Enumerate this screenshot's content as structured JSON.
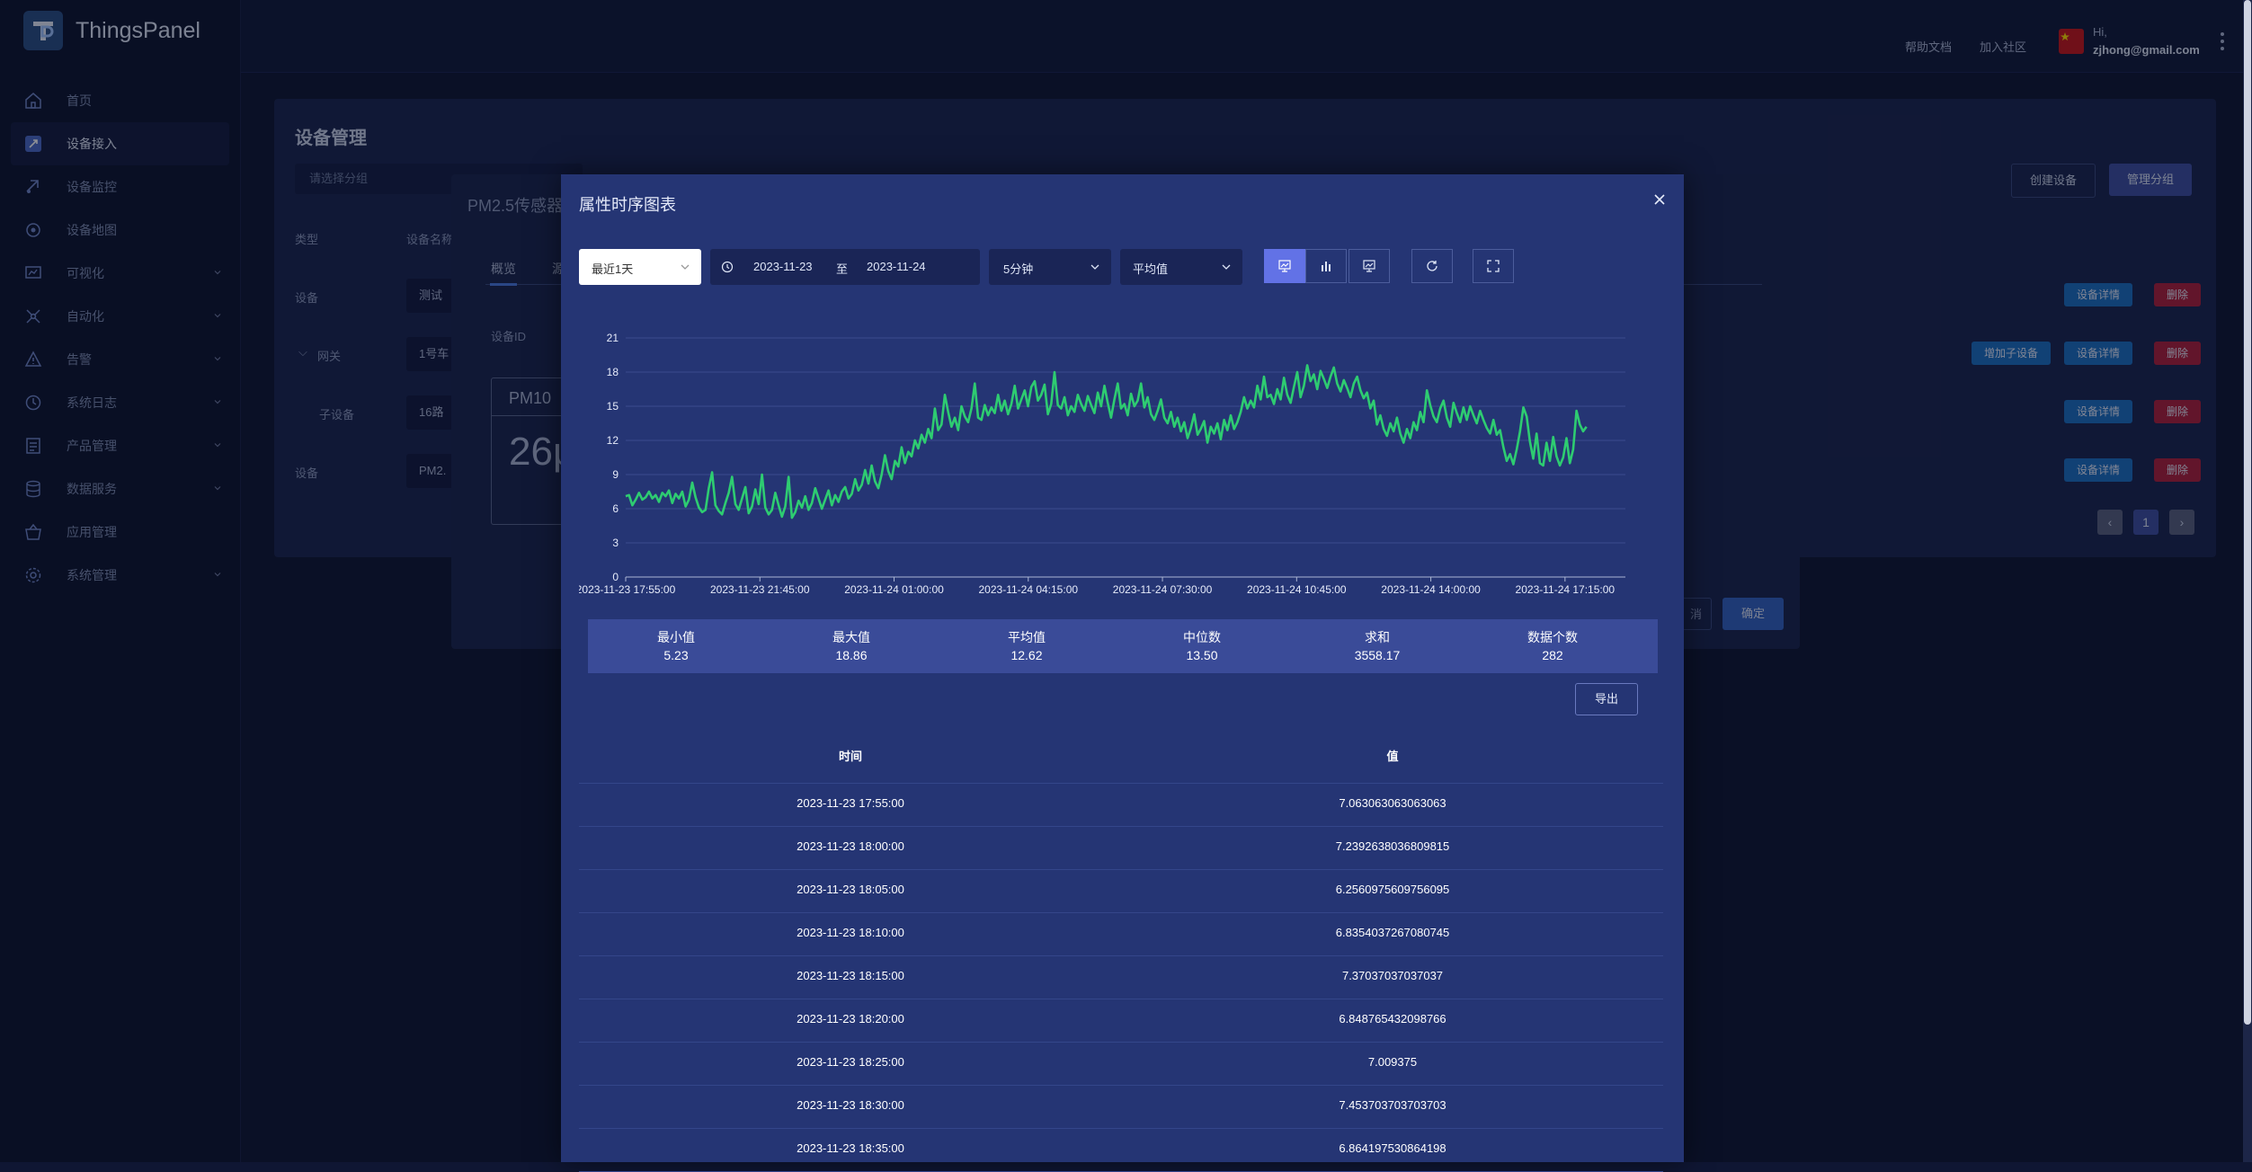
{
  "app": {
    "name": "ThingsPanel"
  },
  "sidebar": {
    "items": [
      {
        "label": "首页",
        "icon": "home-icon",
        "active": false,
        "expandable": false
      },
      {
        "label": "设备接入",
        "icon": "device-access-icon",
        "active": true,
        "expandable": false
      },
      {
        "label": "设备监控",
        "icon": "device-monitor-icon",
        "active": false,
        "expandable": false
      },
      {
        "label": "设备地图",
        "icon": "device-map-icon",
        "active": false,
        "expandable": false
      },
      {
        "label": "可视化",
        "icon": "visualization-icon",
        "active": false,
        "expandable": true
      },
      {
        "label": "自动化",
        "icon": "automation-icon",
        "active": false,
        "expandable": true
      },
      {
        "label": "告警",
        "icon": "alarm-icon",
        "active": false,
        "expandable": true
      },
      {
        "label": "系统日志",
        "icon": "system-log-icon",
        "active": false,
        "expandable": true
      },
      {
        "label": "产品管理",
        "icon": "product-icon",
        "active": false,
        "expandable": true
      },
      {
        "label": "数据服务",
        "icon": "data-service-icon",
        "active": false,
        "expandable": true
      },
      {
        "label": "应用管理",
        "icon": "app-management-icon",
        "active": false,
        "expandable": false
      },
      {
        "label": "系统管理",
        "icon": "system-settings-icon",
        "active": false,
        "expandable": true
      }
    ]
  },
  "header": {
    "help_docs": "帮助文档",
    "join_community": "加入社区",
    "greeting": "Hi,",
    "email": "zjhong@gmail.com"
  },
  "background": {
    "title": "设备管理",
    "group_select_placeholder": "请选择分组",
    "create_device": "创建设备",
    "manage_group": "管理分组",
    "col_type": "类型",
    "col_name": "设备名称",
    "rows": [
      {
        "type": "设备",
        "name": "测试"
      },
      {
        "type": "网关",
        "name": "1号车"
      },
      {
        "type": "子设备",
        "name": "16路"
      },
      {
        "type": "设备",
        "name": "PM2."
      }
    ],
    "detail_btn": "设备详情",
    "delete_btn": "删除",
    "add_child_btn": "增加子设备",
    "page": "1"
  },
  "device_modal": {
    "title": "PM2.5传感器",
    "tab_overview": "概览",
    "tab_second": "源",
    "device_id_label": "设备ID",
    "card_title": "PM10",
    "card_value": "26μ",
    "confirm": "确定",
    "cancel": "消"
  },
  "chart_modal": {
    "title": "属性时序图表",
    "range_select": "最近1天",
    "date_start": "2023-11-23",
    "date_sep": "至",
    "date_end": "2023-11-24",
    "interval_select": "5分钟",
    "agg_select": "平均值",
    "export": "导出"
  },
  "stats": [
    {
      "label": "最小值",
      "value": "5.23"
    },
    {
      "label": "最大值",
      "value": "18.86"
    },
    {
      "label": "平均值",
      "value": "12.62"
    },
    {
      "label": "中位数",
      "value": "13.50"
    },
    {
      "label": "求和",
      "value": "3558.17"
    },
    {
      "label": "数据个数",
      "value": "282"
    }
  ],
  "table": {
    "headers": [
      "时间",
      "值"
    ],
    "rows": [
      [
        "2023-11-23 17:55:00",
        "7.063063063063063"
      ],
      [
        "2023-11-23 18:00:00",
        "7.2392638036809815"
      ],
      [
        "2023-11-23 18:05:00",
        "6.2560975609756095"
      ],
      [
        "2023-11-23 18:10:00",
        "6.8354037267080745"
      ],
      [
        "2023-11-23 18:15:00",
        "7.37037037037037"
      ],
      [
        "2023-11-23 18:20:00",
        "6.848765432098766"
      ],
      [
        "2023-11-23 18:25:00",
        "7.009375"
      ],
      [
        "2023-11-23 18:30:00",
        "7.453703703703703"
      ],
      [
        "2023-11-23 18:35:00",
        "6.864197530864198"
      ]
    ]
  },
  "chart_data": {
    "type": "line",
    "title": "",
    "xlabel": "",
    "ylabel": "",
    "ylim": [
      0,
      21
    ],
    "yticks": [
      0,
      3,
      6,
      9,
      12,
      15,
      18,
      21
    ],
    "xtick_labels": [
      "2023-11-23 17:55:00",
      "2023-11-23 21:45:00",
      "2023-11-24 01:00:00",
      "2023-11-24 04:15:00",
      "2023-11-24 07:30:00",
      "2023-11-24 10:45:00",
      "2023-11-24 14:00:00",
      "2023-11-24 17:15:00"
    ],
    "grid": true,
    "line_color": "#2ecc71",
    "series": [
      {
        "values": [
          7.1,
          7.2,
          6.3,
          6.8,
          7.4,
          6.8,
          7.0,
          7.5,
          6.9,
          7.2,
          6.6,
          7.4,
          7.1,
          7.6,
          6.5,
          7.3,
          6.9,
          7.5,
          6.2,
          6.8,
          8.3,
          7.0,
          6.1,
          5.7,
          5.9,
          7.8,
          9.2,
          6.3,
          5.8,
          5.5,
          6.5,
          7.4,
          8.8,
          6.4,
          5.9,
          6.9,
          7.9,
          5.6,
          6.2,
          7.7,
          6.4,
          9.0,
          6.1,
          5.5,
          5.9,
          7.4,
          6.3,
          5.3,
          6.2,
          8.8,
          5.2,
          5.7,
          6.7,
          6.1,
          7.1,
          5.9,
          6.5,
          7.8,
          6.9,
          6.0,
          6.8,
          7.6,
          6.3,
          7.2,
          6.6,
          7.5,
          7.9,
          6.9,
          7.3,
          8.6,
          7.6,
          8.1,
          9.4,
          8.2,
          9.8,
          8.4,
          7.8,
          9.0,
          10.7,
          9.3,
          8.6,
          10.2,
          9.7,
          11.4,
          10.0,
          11.0,
          10.6,
          12.0,
          11.3,
          12.5,
          11.8,
          13.0,
          12.2,
          14.8,
          12.9,
          13.4,
          16.0,
          14.5,
          13.2,
          14.0,
          12.9,
          15.0,
          14.1,
          13.6,
          14.8,
          17.0,
          14.0,
          13.8,
          15.1,
          14.2,
          14.9,
          14.4,
          16.0,
          14.6,
          15.5,
          14.3,
          15.2,
          16.8,
          14.8,
          15.6,
          16.4,
          15.0,
          16.7,
          17.2,
          15.5,
          16.0,
          16.9,
          14.3,
          15.2,
          18.0,
          15.1,
          14.8,
          15.8,
          14.2,
          15.0,
          14.5,
          16.0,
          15.2,
          14.6,
          15.9,
          15.1,
          14.4,
          16.2,
          15.0,
          16.8,
          15.3,
          14.0,
          15.6,
          17.0,
          14.8,
          15.2,
          14.2,
          16.1,
          15.0,
          15.5,
          17.0,
          14.9,
          15.8,
          14.3,
          13.8,
          14.6,
          15.6,
          14.0,
          13.5,
          14.5,
          13.2,
          14.0,
          12.8,
          13.6,
          12.2,
          13.1,
          14.3,
          12.5,
          13.0,
          13.7,
          11.8,
          13.2,
          12.6,
          13.5,
          12.1,
          13.8,
          12.9,
          14.2,
          13.0,
          13.6,
          14.5,
          15.8,
          14.8,
          15.5,
          14.9,
          16.8,
          15.6,
          17.6,
          15.8,
          16.0,
          15.2,
          16.5,
          15.6,
          17.5,
          16.0,
          15.3,
          16.7,
          18.0,
          15.8,
          16.8,
          18.6,
          17.2,
          17.8,
          16.5,
          18.1,
          17.4,
          16.6,
          17.6,
          18.4,
          17.0,
          16.3,
          17.3,
          16.6,
          15.8,
          17.0,
          17.6,
          16.4,
          15.7,
          16.2,
          14.8,
          15.5,
          13.4,
          14.2,
          13.0,
          12.4,
          13.5,
          12.8,
          14.0,
          12.6,
          11.8,
          13.0,
          12.2,
          13.6,
          12.9,
          14.5,
          13.6,
          16.4,
          15.1,
          14.1,
          13.6,
          14.8,
          15.5,
          14.0,
          13.2,
          15.3,
          14.4,
          13.6,
          14.9,
          13.8,
          15.0,
          14.2,
          13.5,
          14.6,
          13.8,
          13.1,
          12.6,
          13.8,
          12.5,
          12.9,
          11.4,
          10.2,
          10.8,
          9.9,
          11.2,
          12.8,
          14.9,
          14.1,
          11.9,
          10.4,
          12.6,
          10.0,
          9.8,
          11.8,
          10.2,
          12.3,
          10.6,
          9.8,
          10.5,
          12.2,
          10.0,
          11.2,
          14.6,
          13.4,
          12.8,
          13.2
        ]
      }
    ]
  }
}
